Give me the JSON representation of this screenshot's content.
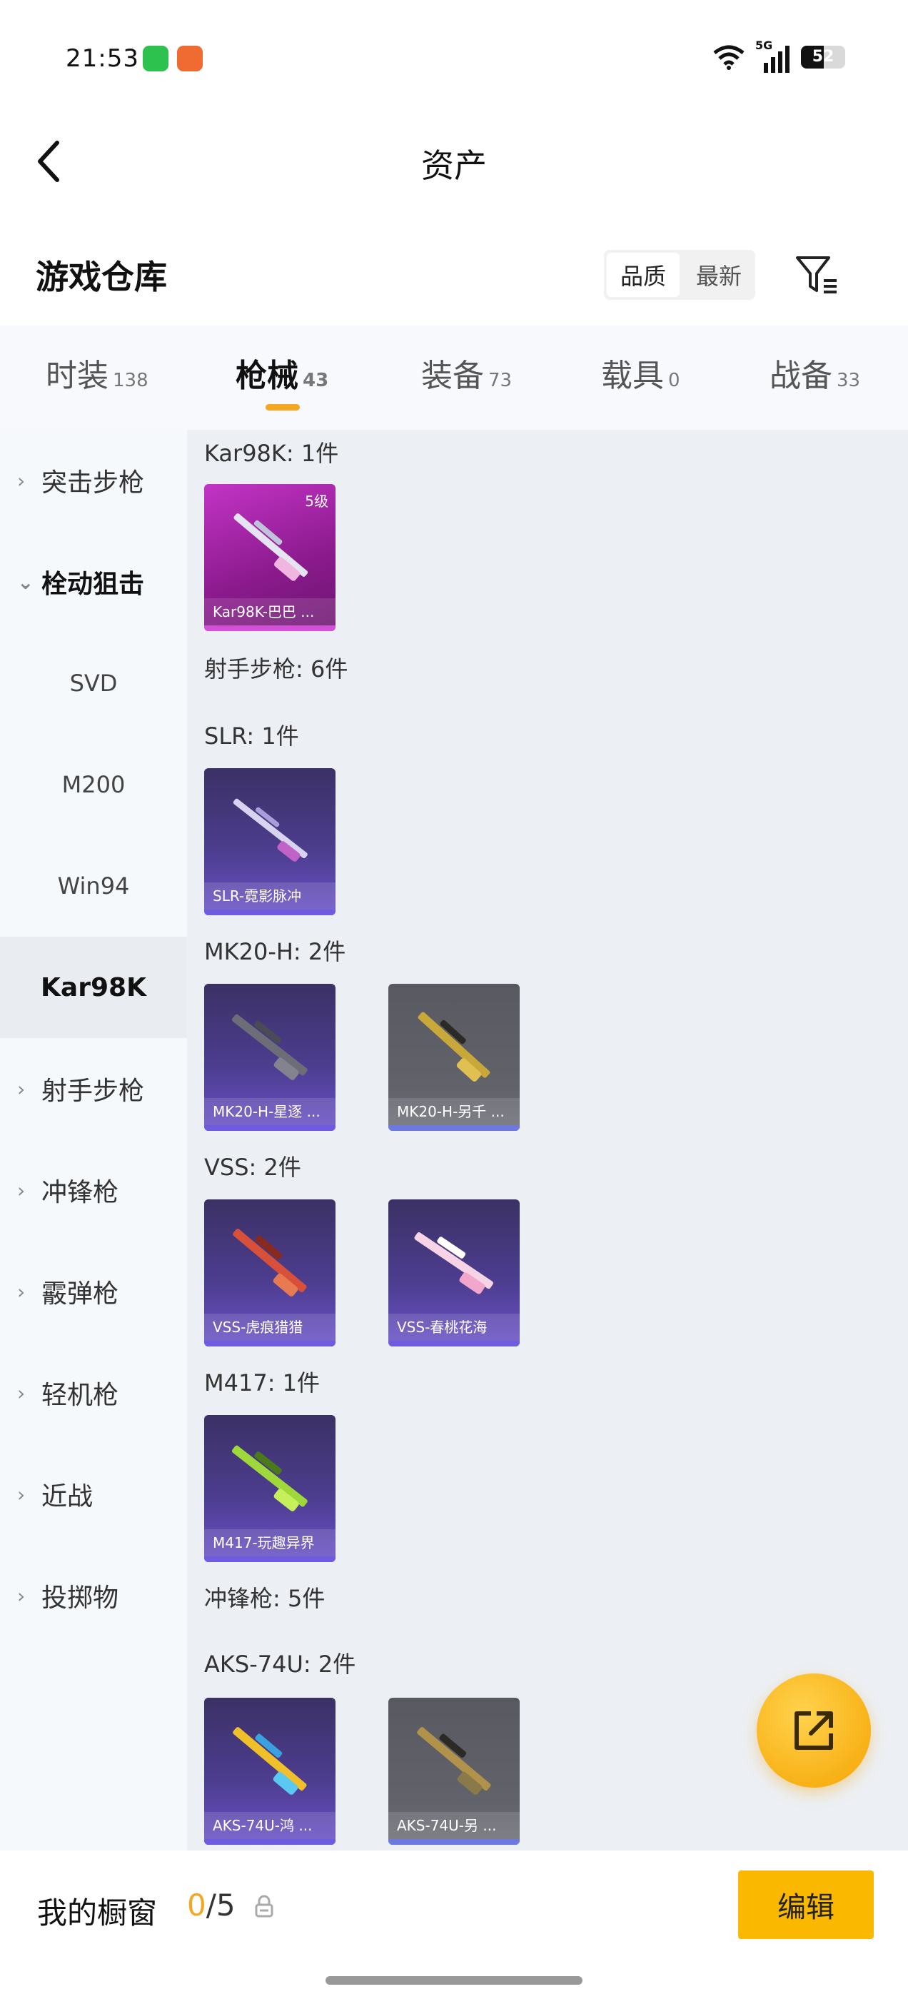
{
  "status_bar": {
    "time": "21:53",
    "battery": "52",
    "network": "5G"
  },
  "header": {
    "title": "资产",
    "back_icon": "chevron-left-icon"
  },
  "warehouse": {
    "title": "游戏仓库",
    "sort": [
      "品质",
      "最新"
    ],
    "active_sort": "品质",
    "filter_icon": "filter-icon"
  },
  "tabs": [
    {
      "label": "时装",
      "count": "138"
    },
    {
      "label": "枪械",
      "count": "43"
    },
    {
      "label": "装备",
      "count": "73"
    },
    {
      "label": "载具",
      "count": "0"
    },
    {
      "label": "战备",
      "count": "33"
    }
  ],
  "active_tab": "枪械",
  "sidebar": {
    "items": [
      {
        "label": "突击步枪",
        "type": "group"
      },
      {
        "label": "栓动狙击",
        "type": "group-open"
      },
      {
        "label": "SVD",
        "type": "sub"
      },
      {
        "label": "M200",
        "type": "sub"
      },
      {
        "label": "Win94",
        "type": "sub"
      },
      {
        "label": "Kar98K",
        "type": "sub-selected"
      },
      {
        "label": "射手步枪",
        "type": "group"
      },
      {
        "label": "冲锋枪",
        "type": "group"
      },
      {
        "label": "霰弹枪",
        "type": "group"
      },
      {
        "label": "轻机枪",
        "type": "group"
      },
      {
        "label": "近战",
        "type": "group"
      },
      {
        "label": "投掷物",
        "type": "group"
      }
    ]
  },
  "content": {
    "sections": [
      {
        "label": "Kar98K: 1件"
      },
      {
        "label": "射手步枪: 6件"
      },
      {
        "label": "SLR: 1件"
      },
      {
        "label": "MK20-H: 2件"
      },
      {
        "label": "VSS: 2件"
      },
      {
        "label": "M417: 1件"
      },
      {
        "label": "冲锋枪: 5件"
      },
      {
        "label": "AKS-74U: 2件"
      }
    ],
    "items": [
      {
        "name": "Kar98K-巴巴 ...",
        "level": "5级",
        "rarity": "pink"
      },
      {
        "name": "SLR-霓影脉冲",
        "rarity": "purple"
      },
      {
        "name": "MK20-H-星逐 ...",
        "rarity": "purple"
      },
      {
        "name": "MK20-H-另千 ...",
        "rarity": "grey"
      },
      {
        "name": "VSS-虎痕猎猎",
        "rarity": "purple"
      },
      {
        "name": "VSS-春桃花海",
        "rarity": "purple"
      },
      {
        "name": "M417-玩趣异界",
        "rarity": "purple"
      },
      {
        "name": "AKS-74U-鸿 ...",
        "rarity": "purple"
      },
      {
        "name": "AKS-74U-另 ...",
        "rarity": "grey"
      }
    ]
  },
  "share_icon": "share-icon",
  "bottom": {
    "showcase_label": "我的橱窗",
    "current": "0",
    "total": "/5",
    "edit_label": "编辑"
  }
}
